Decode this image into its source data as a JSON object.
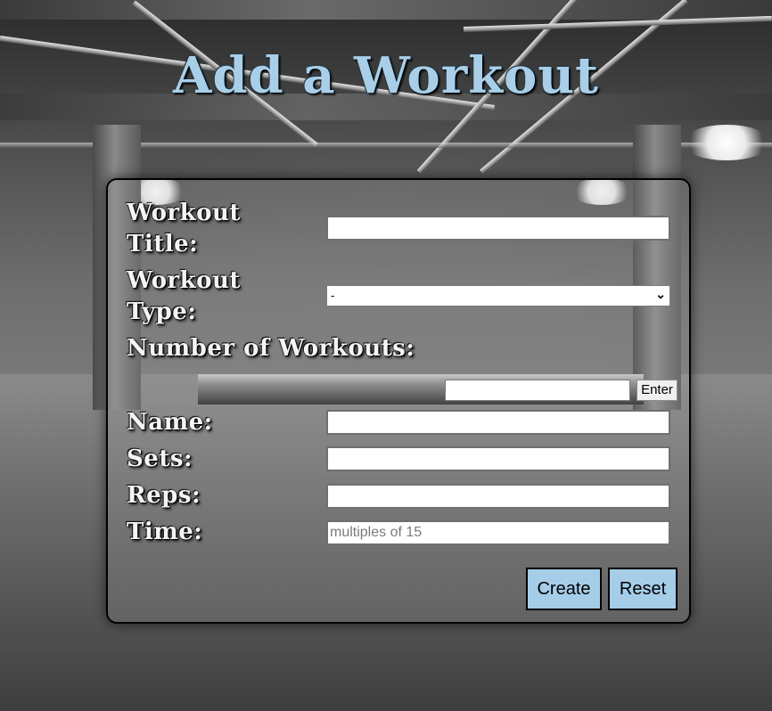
{
  "page": {
    "title": "Add a Workout",
    "accent_color": "#a5cde8",
    "background": "gym-interior-grayscale-photo"
  },
  "form": {
    "workout_title": {
      "label": "Workout Title:",
      "value": ""
    },
    "workout_type": {
      "label": "Workout Type:",
      "selected": "-"
    },
    "number_of_workouts": {
      "label": "Number of Workouts:",
      "value": "",
      "enter_label": "Enter"
    },
    "name": {
      "label": "Name:",
      "value": ""
    },
    "sets": {
      "label": "Sets:",
      "value": ""
    },
    "reps": {
      "label": "Reps:",
      "value": ""
    },
    "time": {
      "label": "Time:",
      "value": "",
      "placeholder": "multiples of 15"
    },
    "create_label": "Create",
    "reset_label": "Reset"
  }
}
